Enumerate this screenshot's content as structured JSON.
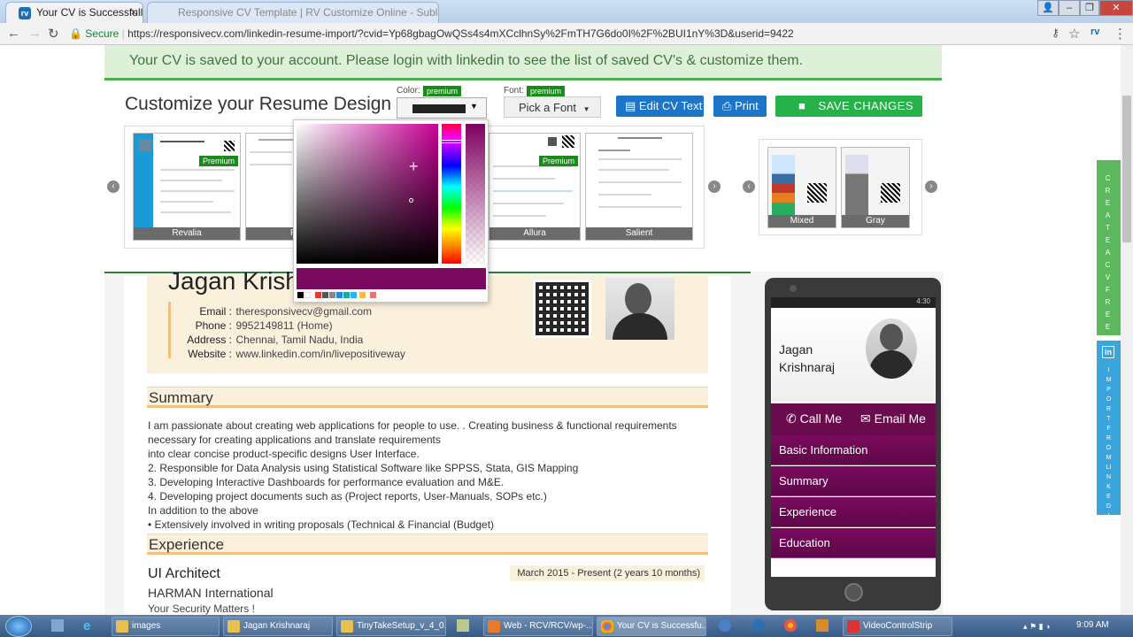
{
  "browser": {
    "tab_title": "Your CV is Successfully In",
    "bg_tab_title": "Responsive CV Template | RV Customize Online - Sublime Studio",
    "secure_label": "Secure",
    "url": "https://responsivecv.com/linkedin-resume-import/?cvid=Yp68gbagOwQSs4s4mXCclhnSy%2FmTH7G6do0I%2F%2BUI1nY%3D&userid=9422"
  },
  "banner": "Your CV is saved to your account. Please login with linkedin to see the list of saved CV's & customize them.",
  "customize": {
    "title": "Customize your Resume Design",
    "color_label": "Color:",
    "font_label": "Font:",
    "premium": "premium",
    "font_button": "Pick a Font",
    "edit_button": "Edit CV Text",
    "print_button": "Print",
    "save_button": "SAVE CHANGES"
  },
  "templates": [
    {
      "name": "Revalia",
      "premium": "Premium"
    },
    {
      "name": "R"
    },
    {
      "name": "Allura",
      "premium": "Premium"
    },
    {
      "name": "Salient"
    }
  ],
  "styles": [
    {
      "name": "Mixed"
    },
    {
      "name": "Gray"
    }
  ],
  "colors": {
    "selected": "#7a0a5e",
    "accent": "#1e74c6",
    "save": "#26b14a",
    "palette": [
      "#000000",
      "#ffffff",
      "#e53935",
      "#555555",
      "#888888",
      "#1e88e5",
      "#26a69a",
      "#29b6f6",
      "#ffb74d",
      "#e57373"
    ]
  },
  "resume": {
    "name": "Jagan Krishnaraj",
    "contact": [
      {
        "label": "Email :",
        "value": "theresponsivecv@gmail.com"
      },
      {
        "label": "Phone :",
        "value": "9952149811 (Home)"
      },
      {
        "label": "Address :",
        "value": "Chennai, Tamil Nadu, India"
      },
      {
        "label": "Website :",
        "value": "www.linkedin.com/in/livepositiveway"
      }
    ],
    "summary_heading": "Summary",
    "summary_lines": [
      "I am passionate about creating web applications for people to use. . Creating business & functional requirements",
      "necessary for creating applications and translate requirements",
      "into clear concise product-specific designs User Interface.",
      "2. Responsible for Data Analysis using Statistical Software like SPPSS, Stata, GIS Mapping",
      "3. Developing Interactive Dashboards for performance evaluation and M&E.",
      "4. Developing project documents such as (Project reports, User-Manuals, SOPs etc.)",
      "In addition to the above",
      "• Extensively involved in writing proposals (Technical & Financial (Budget)"
    ],
    "experience_heading": "Experience",
    "job_title": "UI Architect",
    "job_dates": "March 2015 - Present (2 years 10 months)",
    "company": "HARMAN International",
    "company_tagline": "Your Security Matters !"
  },
  "phone": {
    "status_time": "4:30",
    "first": "Jagan",
    "last": "Krishnaraj",
    "call": "Call Me",
    "email": "Email Me",
    "menu": [
      "Basic Information",
      "Summary",
      "Experience",
      "Education"
    ]
  },
  "side": {
    "create": "CREATE A CV FREE",
    "import": "IMPORT FROM LINKEDIN"
  },
  "taskbar": {
    "items": [
      "images",
      "Jagan Krishnaraj",
      "TinyTakeSetup_v_4_0...",
      "Web - RCV/RCV/wp-...",
      "Your CV is Successfu...",
      "VideoControlStrip"
    ],
    "time": "9:09 AM"
  }
}
